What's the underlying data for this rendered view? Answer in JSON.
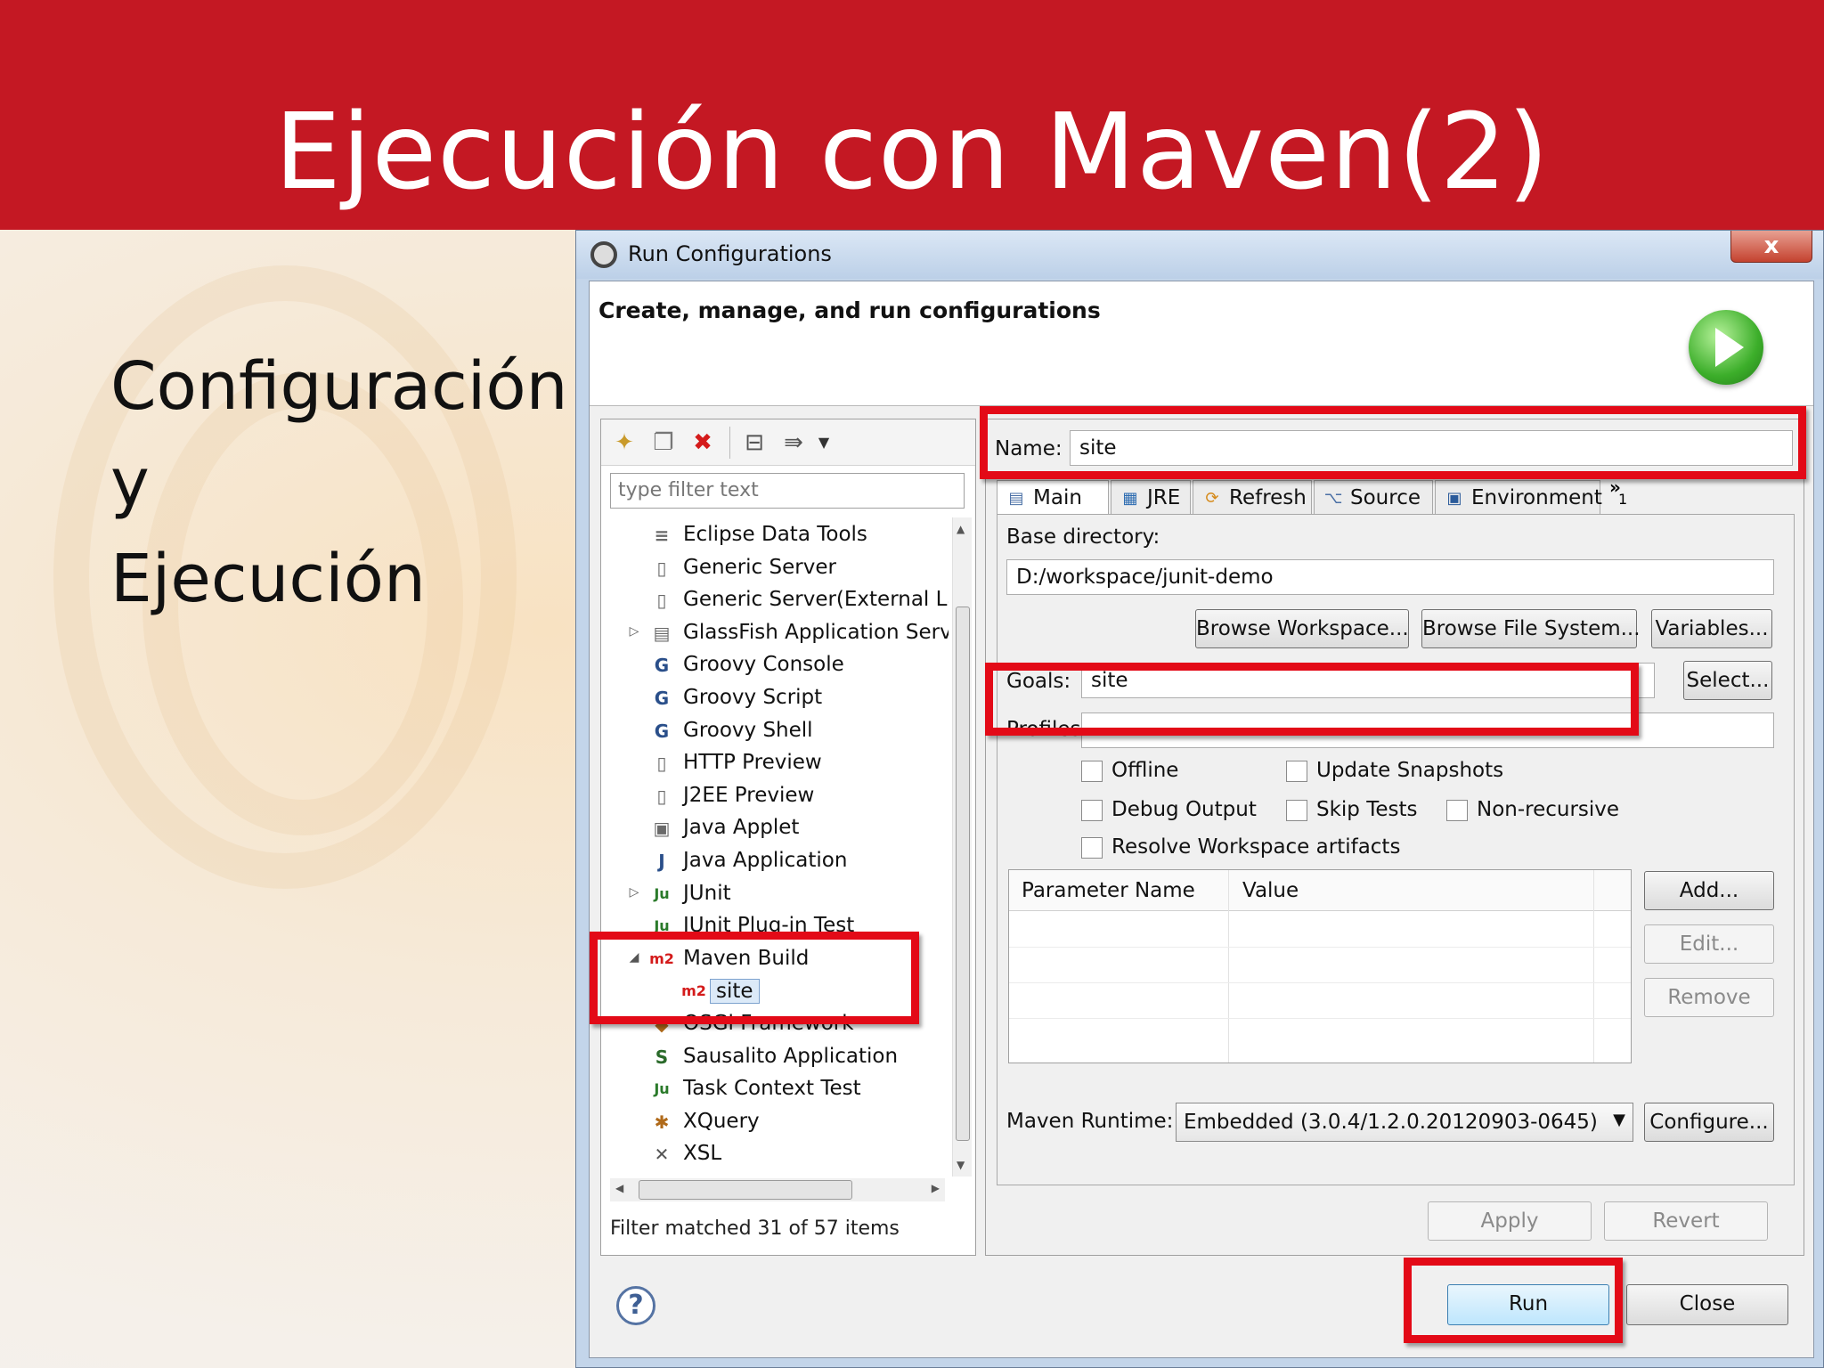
{
  "slide": {
    "title": "Ejecución con Maven(2)",
    "body_lines": [
      "Configuración",
      "y",
      "Ejecución"
    ],
    "colors": {
      "header": "#c41823",
      "highlight": "#e30a17"
    }
  },
  "dialog": {
    "title": "Run Configurations",
    "close_label": "x",
    "banner_title": "Create, manage, and run configurations",
    "banner_icon": "run-icon",
    "left": {
      "filter_placeholder": "type filter text",
      "tree": [
        {
          "label": "Eclipse Data Tools",
          "icon": "database-icon",
          "glyph": "≡"
        },
        {
          "label": "Generic Server",
          "icon": "server-icon",
          "glyph": "▯"
        },
        {
          "label": "Generic Server(External La",
          "icon": "server-icon",
          "glyph": "▯"
        },
        {
          "label": "GlassFish Application Serv",
          "icon": "glassfish-icon",
          "glyph": "▤",
          "expandable": "▷"
        },
        {
          "label": "Groovy Console",
          "icon": "groovy-icon",
          "glyph": "G"
        },
        {
          "label": "Groovy Script",
          "icon": "groovy-icon",
          "glyph": "G"
        },
        {
          "label": "Groovy Shell",
          "icon": "groovy-icon",
          "glyph": "G"
        },
        {
          "label": "HTTP Preview",
          "icon": "server-icon",
          "glyph": "▯"
        },
        {
          "label": "J2EE Preview",
          "icon": "server-icon",
          "glyph": "▯"
        },
        {
          "label": "Java Applet",
          "icon": "applet-icon",
          "glyph": "▣"
        },
        {
          "label": "Java Application",
          "icon": "java-app-icon",
          "glyph": "J"
        },
        {
          "label": "JUnit",
          "icon": "junit-icon",
          "glyph": "Ju",
          "expandable": "▷"
        },
        {
          "label": "JUnit Plug-in Test",
          "icon": "junit-plugin-icon",
          "glyph": "Ju"
        },
        {
          "label": "Maven Build",
          "icon": "maven-icon",
          "glyph": "m2",
          "expandable": "◢"
        },
        {
          "label": "site",
          "icon": "maven-icon",
          "glyph": "m2",
          "child": true,
          "selected": true
        },
        {
          "label": "OSGi Framework",
          "icon": "osgi-icon",
          "glyph": "◆"
        },
        {
          "label": "Sausalito Application",
          "icon": "sausalito-icon",
          "glyph": "S"
        },
        {
          "label": "Task Context Test",
          "icon": "task-icon",
          "glyph": "Ju"
        },
        {
          "label": "XQuery",
          "icon": "xquery-icon",
          "glyph": "✱"
        },
        {
          "label": "XSL",
          "icon": "xsl-icon",
          "glyph": "✕"
        }
      ],
      "status": "Filter matched 31 of 57 items"
    },
    "right": {
      "name_label": "Name:",
      "name_value": "site",
      "tabs": [
        {
          "label": "Main",
          "icon": "main-tab-icon",
          "glyph": "▤"
        },
        {
          "label": "JRE",
          "icon": "jre-icon",
          "glyph": "▦"
        },
        {
          "label": "Refresh",
          "icon": "refresh-icon",
          "glyph": "⟳"
        },
        {
          "label": "Source",
          "icon": "source-icon",
          "glyph": "⌥"
        },
        {
          "label": "Environment",
          "icon": "environment-icon",
          "glyph": "▣"
        }
      ],
      "more_tabs": "»",
      "more_count": "1",
      "base_dir_label": "Base directory:",
      "base_dir_value": "D:/workspace/junit-demo",
      "browse_workspace": "Browse Workspace...",
      "browse_fs": "Browse File System...",
      "variables": "Variables...",
      "goals_label": "Goals:",
      "goals_value": "site",
      "select": "Select...",
      "profiles_label": "Profiles:",
      "profiles_value": "",
      "checkboxes": {
        "offline": "Offline",
        "update_snapshots": "Update Snapshots",
        "debug_output": "Debug Output",
        "skip_tests": "Skip Tests",
        "non_recursive": "Non-recursive",
        "resolve_workspace": "Resolve Workspace artifacts"
      },
      "param_cols": [
        "Parameter Name",
        "Value"
      ],
      "add": "Add...",
      "edit": "Edit...",
      "remove": "Remove",
      "runtime_label": "Maven Runtime:",
      "runtime_value": "Embedded (3.0.4/1.2.0.20120903-0645)",
      "configure": "Configure...",
      "apply": "Apply",
      "revert": "Revert"
    },
    "help_label": "?",
    "run": "Run",
    "close": "Close"
  }
}
